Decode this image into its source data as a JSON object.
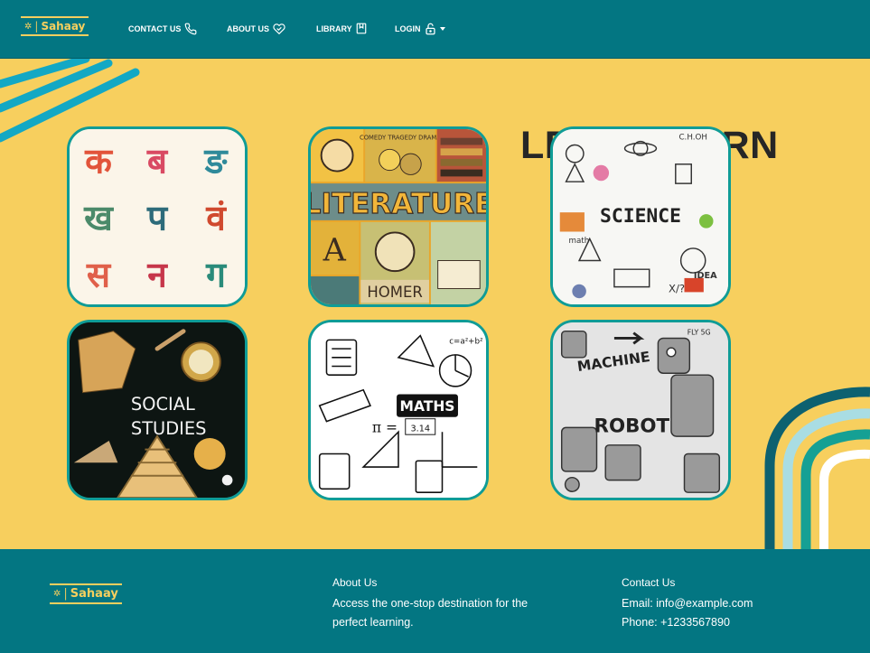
{
  "brand": {
    "name": "Sahaay",
    "separator": "|"
  },
  "nav": {
    "contact": {
      "label": "CONTACT US",
      "icon": "phone-icon"
    },
    "about": {
      "label": "ABOUT US",
      "icon": "heart-handshake-icon"
    },
    "library": {
      "label": "LIBRARY",
      "icon": "book-icon"
    },
    "login": {
      "label": "LOGIN",
      "icon": "lock-icon"
    }
  },
  "hero": {
    "title": "LET'S LEARN"
  },
  "subjects": [
    {
      "name": "hindi",
      "image_text": [
        "क",
        "ब",
        "ङ",
        "ख",
        "प",
        "वं",
        "स",
        "न",
        "ग"
      ]
    },
    {
      "name": "literature",
      "image_text": {
        "header": "COMEDY TRAGEDY DRAMA",
        "title": "LITERATURE",
        "bottom": "HOMER",
        "letter": "A"
      }
    },
    {
      "name": "science",
      "image_text": {
        "title": "SCIENCE",
        "formula": "C.H.OH",
        "tag": "IDEA",
        "ratio": "X/?",
        "label": "math"
      }
    },
    {
      "name": "social-studies",
      "image_text": {
        "line1": "SOCIAL",
        "line2": "STUDIES"
      }
    },
    {
      "name": "maths",
      "image_text": {
        "title": "MATHS",
        "formula": "c=a²+b²",
        "pi": "π =",
        "pi_value": "3.14"
      }
    },
    {
      "name": "robotics",
      "image_text": {
        "line1": "MACHINE",
        "line2": "ROBOT",
        "tag": "FLY 5G"
      }
    }
  ],
  "footer": {
    "about": {
      "heading": "About Us",
      "text": "Access the one-stop destination for the perfect learning."
    },
    "contact": {
      "heading": "Contact Us",
      "email": "Email: info@example.com",
      "phone": "Phone: +1233567890"
    }
  },
  "colors": {
    "teal": "#037682",
    "yellow": "#f7cf5e",
    "border": "#109c96",
    "title": "#262626"
  }
}
